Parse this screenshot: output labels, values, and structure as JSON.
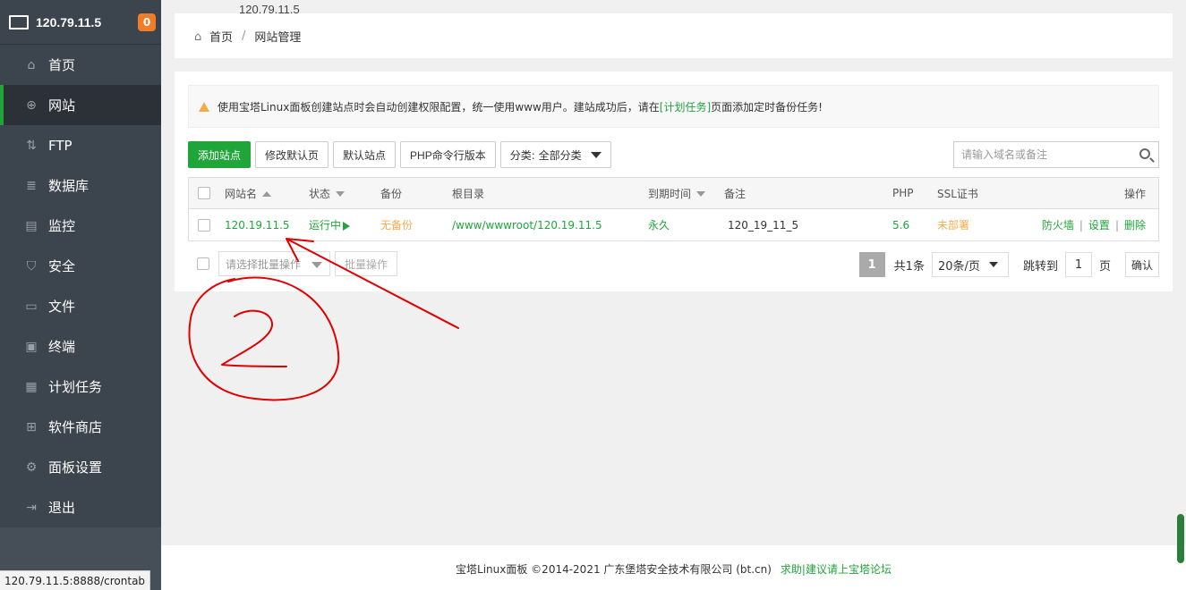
{
  "sidebar": {
    "host": "120.79.11.5",
    "badge": "0",
    "items": [
      {
        "label": "首页",
        "icon": "home-icon",
        "glyph": "⌂"
      },
      {
        "label": "网站",
        "icon": "globe-icon",
        "glyph": "⊕"
      },
      {
        "label": "FTP",
        "icon": "ftp-icon",
        "glyph": "⇅"
      },
      {
        "label": "数据库",
        "icon": "database-icon",
        "glyph": "≣"
      },
      {
        "label": "监控",
        "icon": "monitor-chart-icon",
        "glyph": "▤"
      },
      {
        "label": "安全",
        "icon": "shield-icon",
        "glyph": "⛉"
      },
      {
        "label": "文件",
        "icon": "folder-icon",
        "glyph": "▭"
      },
      {
        "label": "终端",
        "icon": "terminal-icon",
        "glyph": "▣"
      },
      {
        "label": "计划任务",
        "icon": "calendar-icon",
        "glyph": "▦"
      },
      {
        "label": "软件商店",
        "icon": "apps-grid-icon",
        "glyph": "⊞"
      },
      {
        "label": "面板设置",
        "icon": "gear-icon",
        "glyph": "⚙"
      },
      {
        "label": "退出",
        "icon": "logout-icon",
        "glyph": "⇥"
      }
    ]
  },
  "top_ip": "120.79.11.5",
  "breadcrumb": {
    "home": "首页",
    "sep": "/",
    "current": "网站管理"
  },
  "alert": {
    "text_before": "使用宝塔Linux面板创建站点时会自动创建权限配置，统一使用www用户。建站成功后，请在",
    "link": "[计划任务]",
    "text_after": "页面添加定时备份任务!"
  },
  "toolbar": {
    "add_site": "添加站点",
    "edit_default_page": "修改默认页",
    "default_site": "默认站点",
    "php_cli": "PHP命令行版本",
    "category": "分类: 全部分类"
  },
  "search": {
    "placeholder": "请输入域名或备注"
  },
  "table": {
    "headers": {
      "name": "网站名",
      "status": "状态",
      "backup": "备份",
      "root": "根目录",
      "expire": "到期时间",
      "remark": "备注",
      "php": "PHP",
      "ssl": "SSL证书",
      "ops": "操作"
    },
    "rows": [
      {
        "name": "120.19.11.5",
        "status": "运行中",
        "backup": "无备份",
        "root": "/www/wwwroot/120.19.11.5",
        "expire": "永久",
        "remark": "120_19_11_5",
        "php": "5.6",
        "ssl": "未部署",
        "op_firewall": "防火墙",
        "op_settings": "设置",
        "op_delete": "删除"
      }
    ]
  },
  "batch": {
    "placeholder": "请选择批量操作",
    "button": "批量操作"
  },
  "pager": {
    "current": "1",
    "total": "共1条",
    "per_page": "20条/页",
    "jump_label": "跳转到",
    "jump_value": "1",
    "page_unit": "页",
    "confirm": "确认"
  },
  "footer": {
    "copyright": "宝塔Linux面板 ©2014-2021 广东堡塔安全技术有限公司 (bt.cn)",
    "help_link": "求助|建议请上宝塔论坛"
  },
  "statusbar_url": "120.79.11.5:8888/crontab",
  "colors": {
    "accent": "#20a53a",
    "warning": "#f0ad4e",
    "sidebar": "#3c444d",
    "annotation": "#e00000"
  }
}
